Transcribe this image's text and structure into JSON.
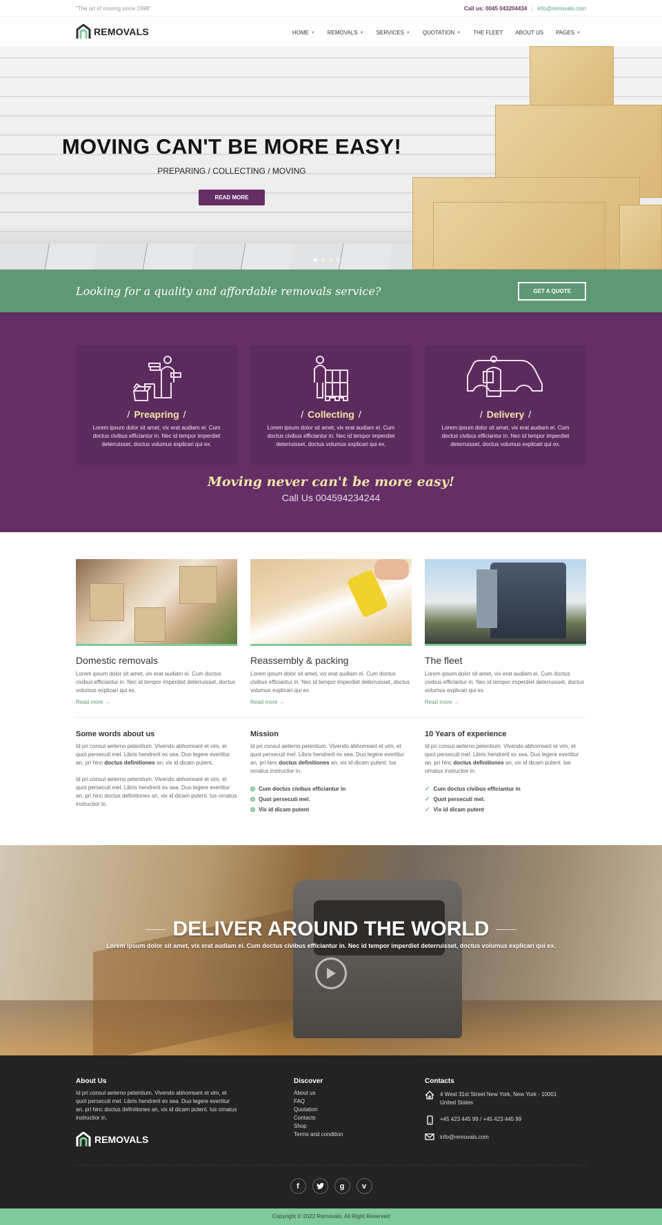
{
  "topbar": {
    "motto": "\"The art of moving since 1998\"",
    "phone": "Call us: 0045 043204434",
    "email": "info@removals.com"
  },
  "header": {
    "logo_text": "REMOVALS",
    "nav": [
      {
        "label": "HOME",
        "dropdown": true
      },
      {
        "label": "REMOVALS",
        "dropdown": true
      },
      {
        "label": "SERVICES",
        "dropdown": true
      },
      {
        "label": "QUOTATION",
        "dropdown": true
      },
      {
        "label": "THE FLEET",
        "dropdown": false
      },
      {
        "label": "ABOUT US",
        "dropdown": false
      },
      {
        "label": "PAGES",
        "dropdown": true
      }
    ]
  },
  "hero": {
    "title": "MOVING CAN'T BE MORE EASY!",
    "subtitle": "PREPARING / COLLECTING / MOVING",
    "button": "READ MORE",
    "slide_count": 4,
    "active_slide": 1
  },
  "band": {
    "text": "Looking for a quality and affordable removals service?",
    "button": "GET A QUOTE"
  },
  "process": {
    "cards": [
      {
        "icon": "packing-person-icon",
        "title": "Preapring",
        "text": "Lorem ipsum dolor sit amet, vix erat audiam ei. Cum doctus civibus efficiantur in. Nec id tempor imperdiet deterruisset, doctus volumus explicari qui ex."
      },
      {
        "icon": "pallet-person-icon",
        "title": "Collecting",
        "text": "Lorem ipsum dolor sit amet, vix erat audiam ei. Cum doctus civibus efficiantur in. Nec id tempor imperdiet deterruisset, doctus volumus explicari qui ex."
      },
      {
        "icon": "delivery-van-icon",
        "title": "Delivery",
        "text": "Lorem ipsum dolor sit amet, vix erat audiam ei. Cum doctus civibus efficiantur in. Nec id tempor imperdiet deterruisset, doctus volumus explicari qui ex."
      }
    ],
    "slash": "/",
    "tagline": "Moving never can't be more easy!",
    "call": "Call Us 004594234244"
  },
  "services": {
    "items": [
      {
        "title": "Domestic removals",
        "text": "Lorem ipsum dolor sit amet, vix erat audiam ei. Cum doctus civibus efficiantur in. Nec id tempor imperdiet deterruisset, doctus volumus explicari qui ex.",
        "link": "Read more →"
      },
      {
        "title": "Reassembly & packing",
        "text": "Lorem ipsum dolor sit amet, vix erat audiam ei. Cum doctus civibus efficiantur in. Nec id tempor imperdiet deterruisset, doctus volumus explicari qui ex.",
        "link": "Read more →"
      },
      {
        "title": "The fleet",
        "text": "Lorem ipsum dolor sit amet, vix erat audiam ei. Cum doctus civibus efficiantur in. Nec id tempor imperdiet deterruisset, doctus volumus explicari qui ex.",
        "link": "Read more →"
      }
    ]
  },
  "info": {
    "about": {
      "title": "Some words about us",
      "p1_before": "Id pri consul aeterno petentium. Vivendo abhorreant et vim, et quot persecuti mel. Libris hendrerit ex sea. Duo legere evertitur an, pri hinc ",
      "p1_bold": "doctus definitiones",
      "p1_after": " an, vix id dicam putent.",
      "p2": "Id pri consul aeterno petentium. Vivendo abhorreant et vim, et quot persecuti mel. Libris hendrerit ex sea. Duo legere evertitur an, pri hinc doctus definitiones an, vix id dicam putent. Ius ornatus instructior in."
    },
    "mission": {
      "title": "Mission",
      "p_before": "Id pri consul aeterno petentium. Vivendo abhorreant et vim, et quot persecuti mel. Libris hendrerit ex sea. Duo legere evertitur an, pri hinc ",
      "p_bold": "doctus definitiones",
      "p_after": " an, vix id dicam putent. Ius ornatus instructior in.",
      "bullets": [
        "Cum doctus civibus efficiantur in",
        "Quot persecuti mel.",
        "Vix id dicam putent"
      ]
    },
    "experience": {
      "title": "10 Years of experience",
      "p_before": "Id pri consul aeterno petentium. Vivendo abhorreant et vim, et quot persecuti mel. Libris hendrerit ex sea. Duo legere evertitur an, pri hinc ",
      "p_bold": "doctus definitiones",
      "p_after": " an, vix id dicam putent. Ius ornatus instructior in.",
      "bullets": [
        "Cum doctus civibus efficiantur in",
        "Quot persecuti mel.",
        "Vix id dicam putent"
      ]
    }
  },
  "video": {
    "title": "DELIVER AROUND THE WORLD",
    "text": "Lorem ipsum dolor sit amet, vix erat audiam ei. Cum doctus civibus efficiantur in. Nec id tempor imperdiet deterruisset, doctus volumus explicari qui ex."
  },
  "footer": {
    "about": {
      "title": "About Us",
      "text": "Id pri consul aeterno petentium. Vivendo abhorreant et vim, et quot persecuti mel. Libris hendrerit ex sea. Duo legere evertitur an, pri hinc doctus definitiones an, vix id dicam putent. Ius ornatus instructior in.",
      "logo_text": "REMOVALS"
    },
    "discover": {
      "title": "Discover",
      "links": [
        "About us",
        "FAQ",
        "Quotation",
        "Contacts",
        "Shop",
        "Terms and condition"
      ]
    },
    "contacts": {
      "title": "Contacts",
      "address_line1": "4 West 31st Street New York, New York - 10001",
      "address_line2": "United States",
      "phone": "+45 423 445 99 / +45 423 445 99",
      "email": "info@removals.com"
    },
    "socials": [
      {
        "name": "facebook",
        "glyph": "f"
      },
      {
        "name": "twitter",
        "glyph": "t"
      },
      {
        "name": "google-plus",
        "glyph": "g"
      },
      {
        "name": "vimeo",
        "glyph": "v"
      }
    ],
    "copyright": "Copyright © 2022 Removals, All Right Reserved"
  },
  "colors": {
    "purple": "#652f66",
    "green": "#5f9874",
    "light_green": "#7fc99a",
    "yellow": "#f5e6a9",
    "dark": "#232323"
  }
}
